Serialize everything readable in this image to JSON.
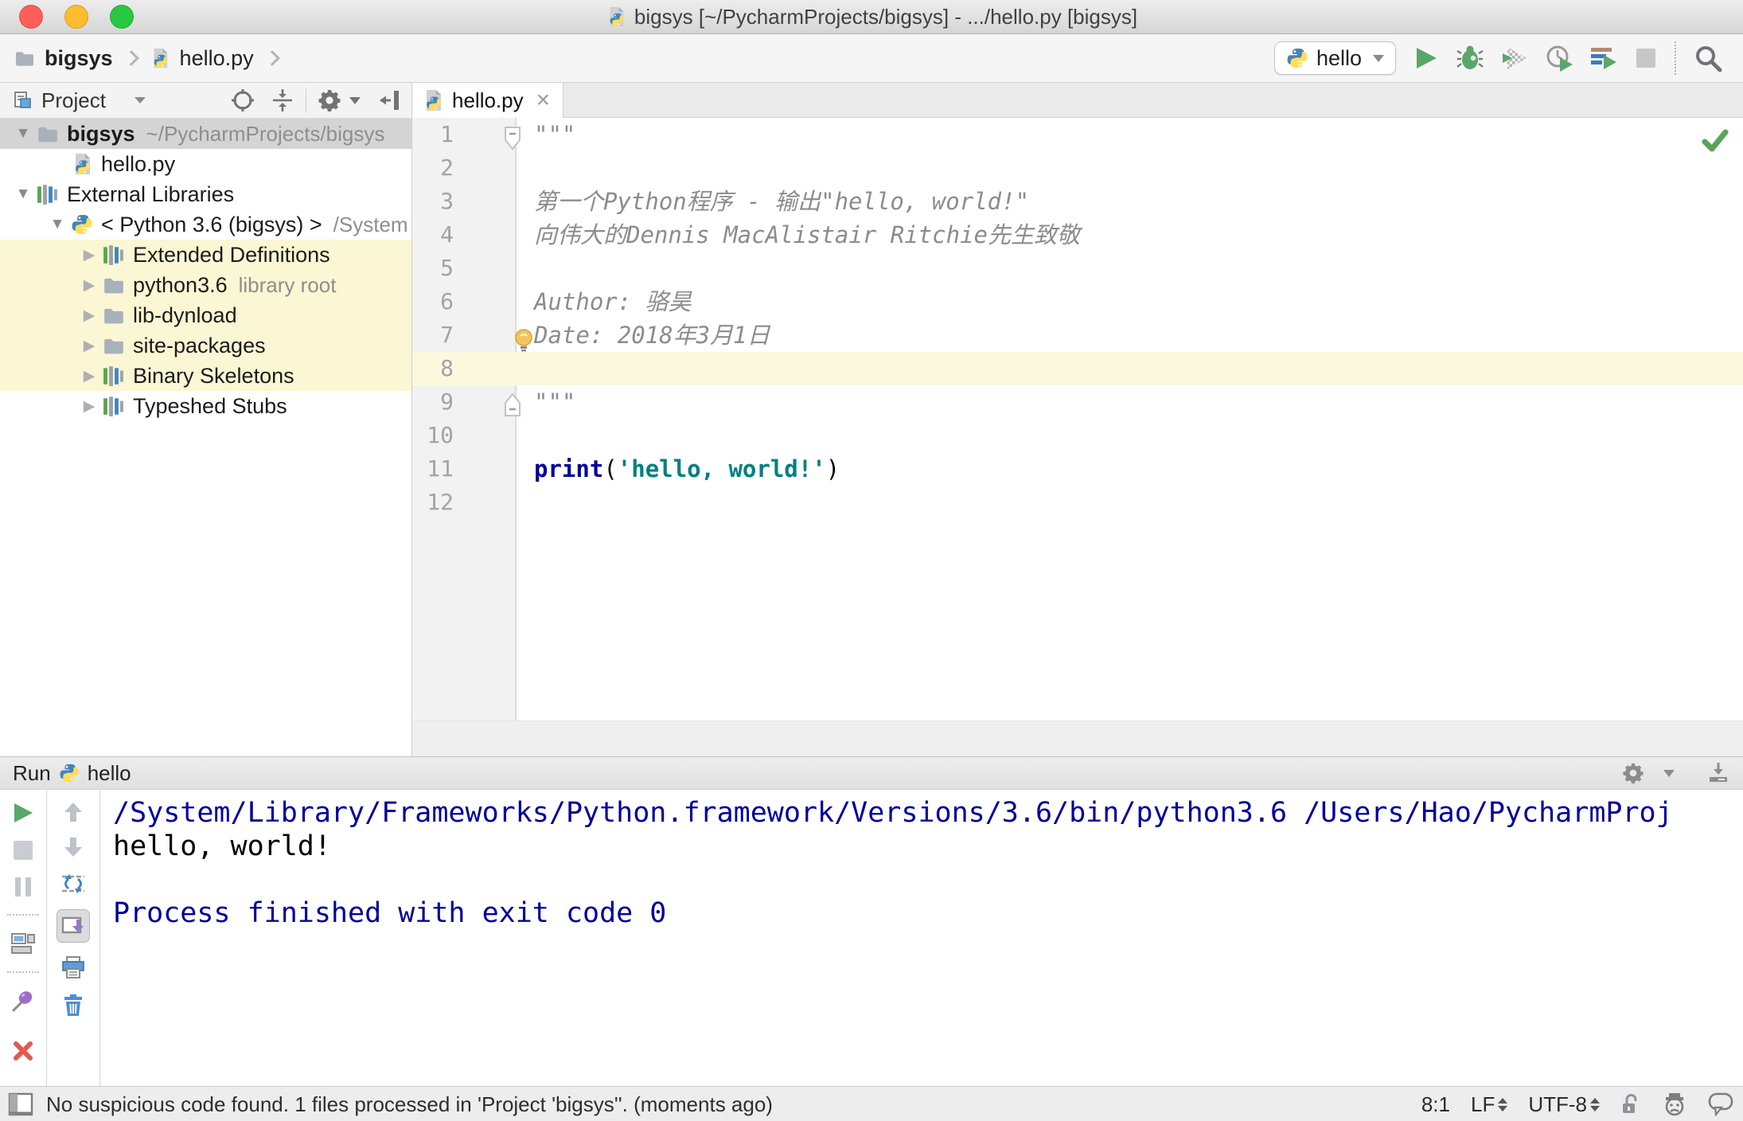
{
  "titlebar": {
    "title": "bigsys [~/PycharmProjects/bigsys] - .../hello.py [bigsys]"
  },
  "breadcrumb": {
    "project": "bigsys",
    "file": "hello.py"
  },
  "toolbar": {
    "run_config": "hello"
  },
  "project_panel": {
    "title": "Project",
    "tree": [
      {
        "label": "bigsys",
        "suffix": "~/PycharmProjects/bigsys",
        "icon": "folder",
        "arrow": "expanded",
        "level": 0,
        "state": "selected",
        "bold": true
      },
      {
        "label": "hello.py",
        "icon": "python-file",
        "arrow": "none",
        "level": 1,
        "state": "",
        "bold": false
      },
      {
        "label": "External Libraries",
        "suffix": "",
        "icon": "library",
        "arrow": "expanded",
        "level": 0,
        "state": "",
        "bold": false
      },
      {
        "label": "< Python 3.6 (bigsys) >",
        "suffix": "/System",
        "icon": "python-logo",
        "arrow": "expanded",
        "level": 1,
        "state": "",
        "bold": false
      },
      {
        "label": "Extended Definitions",
        "icon": "library",
        "arrow": "collapsed",
        "level": 2,
        "state": "highlighted",
        "bold": false
      },
      {
        "label": "python3.6",
        "suffix": "library root",
        "icon": "folder",
        "arrow": "collapsed",
        "level": 2,
        "state": "highlighted",
        "bold": false
      },
      {
        "label": "lib-dynload",
        "icon": "folder",
        "arrow": "collapsed",
        "level": 2,
        "state": "highlighted",
        "bold": false
      },
      {
        "label": "site-packages",
        "icon": "folder",
        "arrow": "collapsed",
        "level": 2,
        "state": "highlighted",
        "bold": false
      },
      {
        "label": "Binary Skeletons",
        "icon": "library",
        "arrow": "collapsed",
        "level": 2,
        "state": "highlighted",
        "bold": false
      },
      {
        "label": "Typeshed Stubs",
        "icon": "library",
        "arrow": "collapsed",
        "level": 2,
        "state": "",
        "bold": false
      }
    ]
  },
  "editor": {
    "tab": "hello.py",
    "current_line": 8,
    "inspection_status": "no-problems",
    "lines": [
      {
        "n": 1,
        "fold": "start",
        "bulb": false,
        "segs": [
          [
            "comment",
            "\"\"\""
          ]
        ]
      },
      {
        "n": 2,
        "fold": "",
        "bulb": false,
        "segs": []
      },
      {
        "n": 3,
        "fold": "",
        "bulb": false,
        "segs": [
          [
            "comment",
            "第一个Python程序 - 输出\"hello, world!\""
          ]
        ]
      },
      {
        "n": 4,
        "fold": "",
        "bulb": false,
        "segs": [
          [
            "comment",
            "向伟大的Dennis MacAlistair Ritchie先生致敬"
          ]
        ]
      },
      {
        "n": 5,
        "fold": "",
        "bulb": false,
        "segs": []
      },
      {
        "n": 6,
        "fold": "",
        "bulb": false,
        "segs": [
          [
            "comment",
            "Author: 骆昊"
          ]
        ]
      },
      {
        "n": 7,
        "fold": "",
        "bulb": true,
        "segs": [
          [
            "comment",
            "Date: 2018年3月1日"
          ]
        ]
      },
      {
        "n": 8,
        "fold": "",
        "bulb": false,
        "segs": []
      },
      {
        "n": 9,
        "fold": "end",
        "bulb": false,
        "segs": [
          [
            "comment",
            "\"\"\""
          ]
        ]
      },
      {
        "n": 10,
        "fold": "",
        "bulb": false,
        "segs": []
      },
      {
        "n": 11,
        "fold": "",
        "bulb": false,
        "segs": [
          [
            "keyword",
            "print"
          ],
          [
            "plain",
            "("
          ],
          [
            "string",
            "'hello, world!'"
          ],
          [
            "plain",
            ")"
          ]
        ]
      },
      {
        "n": 12,
        "fold": "",
        "bulb": false,
        "segs": []
      }
    ]
  },
  "run_panel": {
    "title": "Run",
    "config": "hello",
    "console": [
      {
        "style": "system",
        "text": "/System/Library/Frameworks/Python.framework/Versions/3.6/bin/python3.6 /Users/Hao/PycharmProj"
      },
      {
        "style": "stdout",
        "text": "hello, world!"
      },
      {
        "style": "stdout",
        "text": ""
      },
      {
        "style": "system",
        "text": "Process finished with exit code 0"
      }
    ]
  },
  "statusbar": {
    "message": "No suspicious code found. 1 files processed in 'Project 'bigsys''. (moments ago)",
    "caret": "8:1",
    "line_separator": "LF",
    "encoding": "UTF-8"
  },
  "colors": {
    "run_green": "#59a869",
    "keyword_blue": "#00009c",
    "string_teal": "#008080",
    "console_system": "#00009c",
    "selection_gray": "#d4d4d4",
    "tree_highlight": "#fbf6d3",
    "caret_row": "#fcf8de"
  }
}
